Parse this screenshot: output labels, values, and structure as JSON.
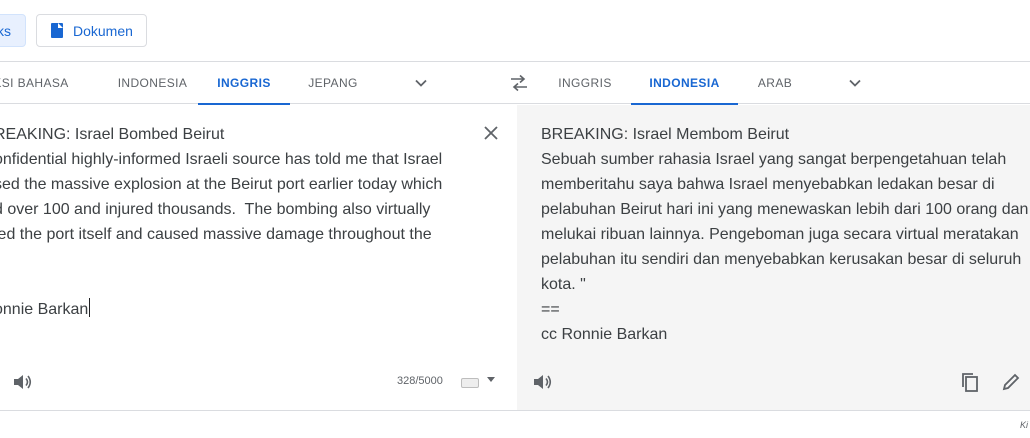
{
  "mode_buttons": {
    "text_label": "ks",
    "document_label": "Dokumen"
  },
  "source": {
    "tabs": [
      {
        "label": "KSI BAHASA",
        "active": false
      },
      {
        "label": "INDONESIA",
        "active": false
      },
      {
        "label": "INGGRIS",
        "active": true
      },
      {
        "label": "JEPANG",
        "active": false
      }
    ],
    "text": "REAKING: Israel Bombed Beirut\nonfidential highly-informed Israeli source has told me that Israel\nsed the massive explosion at the Beirut port earlier today which\nd over 100 and injured thousands.  The bombing also virtually\nled the port itself and caused massive damage throughout the\n\"\n\nonnie Barkan",
    "char_count": "328/5000"
  },
  "target": {
    "tabs": [
      {
        "label": "INGGRIS",
        "active": false
      },
      {
        "label": "INDONESIA",
        "active": true
      },
      {
        "label": "ARAB",
        "active": false
      }
    ],
    "text": "BREAKING: Israel Membom Beirut\nSebuah sumber rahasia Israel yang sangat berpengetahuan telah\nmemberitahu saya bahwa Israel menyebabkan ledakan besar di\npelabuhan Beirut hari ini yang menewaskan lebih dari 100 orang dan\nmelukai ribuan lainnya. Pengeboman juga secara virtual meratakan\npelabuhan itu sendiri dan menyebabkan kerusakan besar di seluruh\nkota. \"\n==\ncc Ronnie Barkan"
  },
  "footer": {
    "feedback_label": "Ki"
  },
  "colors": {
    "accent": "#1967d2",
    "target_bg": "#f5f5f5",
    "border": "#dadce0"
  },
  "icons": [
    "document-icon",
    "chevron-down-icon",
    "swap-icon",
    "close-icon",
    "speaker-icon",
    "keyboard-icon",
    "copy-icon",
    "pencil-icon"
  ]
}
